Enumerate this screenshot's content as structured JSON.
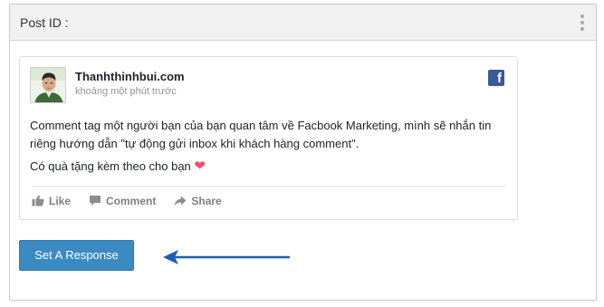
{
  "panel": {
    "title": "Post ID :"
  },
  "post": {
    "author": "Thanhthinhbui.com",
    "time": "khoảng một phút trước",
    "body_line1": "Comment tag một người bạn của bạn quan tâm về Facbook Marketing, mình sẽ nhắn tin riêng hướng dẫn \"tự động gửi inbox khi khách hàng comment\".",
    "body_line2": "Có quà tặng kèm theo cho bạn",
    "logo_letter": "f",
    "actions": {
      "like": "Like",
      "comment": "Comment",
      "share": "Share"
    }
  },
  "respond_button": "Set A Response",
  "colors": {
    "button": "#3b8bc2",
    "facebook": "#3b5998",
    "heart": "#e9516e",
    "arrow": "#1a5fb4"
  },
  "icons": [
    "kebab-menu-icon",
    "facebook-icon",
    "heart-icon",
    "like-icon",
    "comment-icon",
    "share-icon",
    "arrow-icon"
  ]
}
